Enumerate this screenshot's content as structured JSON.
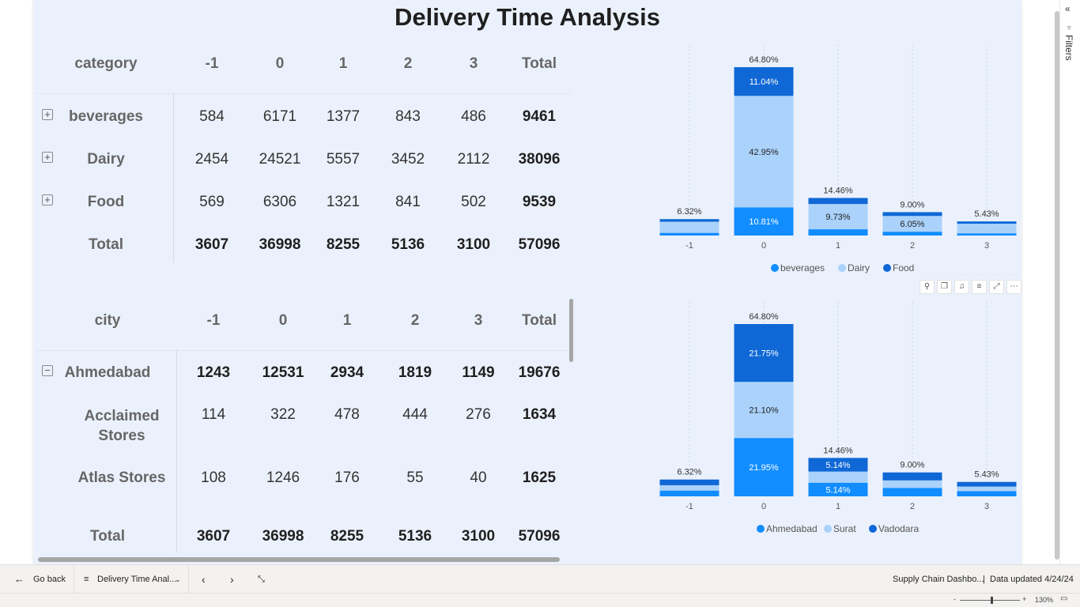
{
  "report": {
    "title": "Delivery Time Analysis"
  },
  "table1": {
    "columns": [
      "category",
      "-1",
      "0",
      "1",
      "2",
      "3",
      "Total"
    ],
    "rows": [
      {
        "label": "beverages",
        "values": [
          "584",
          "6171",
          "1377",
          "843",
          "486"
        ],
        "total": "9461"
      },
      {
        "label": "Dairy",
        "values": [
          "2454",
          "24521",
          "5557",
          "3452",
          "2112"
        ],
        "total": "38096"
      },
      {
        "label": "Food",
        "values": [
          "569",
          "6306",
          "1321",
          "841",
          "502"
        ],
        "total": "9539"
      }
    ],
    "total_row": {
      "label": "Total",
      "values": [
        "3607",
        "36998",
        "8255",
        "5136",
        "3100"
      ],
      "total": "57096"
    }
  },
  "table2": {
    "columns": [
      "city",
      "-1",
      "0",
      "1",
      "2",
      "3",
      "Total"
    ],
    "rows": [
      {
        "label": "Ahmedabad",
        "values": [
          "1243",
          "12531",
          "2934",
          "1819",
          "1149"
        ],
        "total": "19676"
      },
      {
        "label": "Acclaimed Stores",
        "values": [
          "114",
          "322",
          "478",
          "444",
          "276"
        ],
        "total": "1634"
      },
      {
        "label": "Atlas Stores",
        "values": [
          "108",
          "1246",
          "176",
          "55",
          "40"
        ],
        "total": "1625"
      }
    ],
    "total_row": {
      "label": "Total",
      "values": [
        "3607",
        "36998",
        "8255",
        "5136",
        "3100"
      ],
      "total": "57096"
    }
  },
  "chart_data": [
    {
      "type": "bar",
      "stacked": true,
      "categories": [
        "-1",
        "0",
        "1",
        "2",
        "3"
      ],
      "series": [
        {
          "name": "beverages",
          "color": "#118dff",
          "values": [
            1.02,
            10.81,
            2.41,
            1.48,
            0.85
          ]
        },
        {
          "name": "Dairy",
          "color": "#aad2fb",
          "values": [
            4.3,
            42.95,
            9.73,
            6.05,
            3.7
          ]
        },
        {
          "name": "Food",
          "color": "#0f68d6",
          "values": [
            1.0,
            11.04,
            2.32,
            1.47,
            0.88
          ]
        }
      ],
      "totals": [
        "6.32%",
        "64.80%",
        "14.46%",
        "9.00%",
        "5.43%"
      ],
      "segment_labels": [
        [
          "",
          "",
          ""
        ],
        [
          "10.81%",
          "42.95%",
          "11.04%"
        ],
        [
          "",
          "9.73%",
          ""
        ],
        [
          "",
          "6.05%",
          ""
        ],
        [
          "",
          "",
          ""
        ]
      ],
      "legend_position": "bottom-center"
    },
    {
      "type": "bar",
      "stacked": true,
      "categories": [
        "-1",
        "0",
        "1",
        "2",
        "3"
      ],
      "series": [
        {
          "name": "Ahmedabad",
          "color": "#118dff",
          "values": [
            2.18,
            21.95,
            5.14,
            3.19,
            1.98
          ]
        },
        {
          "name": "Surat",
          "color": "#aad2fb",
          "values": [
            2.0,
            21.1,
            4.18,
            2.8,
            1.7
          ]
        },
        {
          "name": "Vadodara",
          "color": "#0f68d6",
          "values": [
            2.14,
            21.75,
            5.14,
            3.01,
            1.75
          ]
        }
      ],
      "totals": [
        "6.32%",
        "64.80%",
        "14.46%",
        "9.00%",
        "5.43%"
      ],
      "segment_labels": [
        [
          "",
          "",
          ""
        ],
        [
          "21.95%",
          "21.10%",
          "21.75%"
        ],
        [
          "5.14%",
          "",
          "5.14%"
        ],
        [
          "",
          "",
          ""
        ],
        [
          "",
          "",
          ""
        ]
      ],
      "legend_position": "bottom-center"
    }
  ],
  "filters": {
    "label": "Filters"
  },
  "bottom_bar": {
    "go_back": "Go back",
    "page_tab": "Delivery Time Anal...",
    "report_name": "Supply Chain Dashbo...",
    "data_updated": "Data updated 4/24/24"
  },
  "status_bar": {
    "zoom_minus": "-",
    "zoom_plus": "+",
    "zoom": "130%"
  }
}
